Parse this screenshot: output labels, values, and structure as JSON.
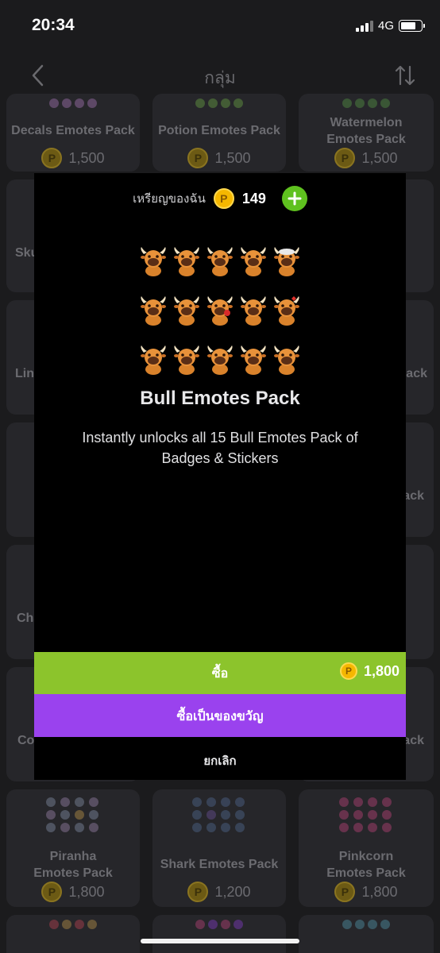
{
  "status_bar": {
    "time": "20:34",
    "network": "4G"
  },
  "nav": {
    "title": "กลุ่ม"
  },
  "background_cards": [
    {
      "title": "Decals Emotes Pack",
      "price": "1,500"
    },
    {
      "title": "Potion Emotes Pack",
      "price": "1,500"
    },
    {
      "title": "Watermelon Emotes Pack",
      "price": "1,500"
    },
    {
      "title": "Piranha Emotes Pack",
      "price": "1,800"
    },
    {
      "title": "Shark Emotes Pack",
      "price": "1,200"
    },
    {
      "title": "Pinkcorn Emotes Pack",
      "price": "1,800"
    }
  ],
  "peek_labels": [
    "Sku",
    "Lin",
    "Cha",
    "Co",
    "ack",
    "ack",
    "ack"
  ],
  "modal": {
    "balance_label": "เหรียญของฉัน",
    "coin_symbol": "P",
    "balance": "149",
    "emote_count": 15,
    "title": "Bull Emotes Pack",
    "description": "Instantly unlocks all 15 Bull Emotes Pack of Badges & Stickers",
    "buy_label": "ซื้อ",
    "buy_price": "1,800",
    "gift_label": "ซื้อเป็นของขวัญ",
    "cancel_label": "ยกเลิก"
  },
  "colors": {
    "buy": "#8cc42c",
    "gift": "#9a42ee",
    "add": "#5fc11f",
    "coin": "#f5b700"
  }
}
